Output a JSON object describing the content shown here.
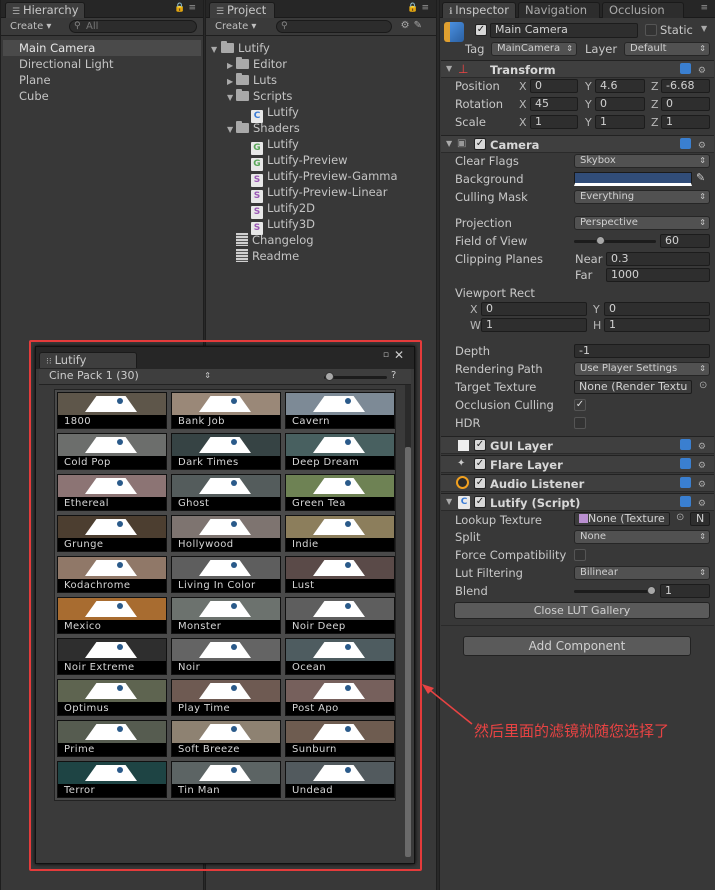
{
  "hierarchy": {
    "tab": "Hierarchy",
    "create": "Create ▾",
    "search_placeholder": "All",
    "items": [
      "Main Camera",
      "Directional Light",
      "Plane",
      "Cube"
    ]
  },
  "project": {
    "tab": "Project",
    "create": "Create ▾",
    "tree": {
      "root": "Lutify",
      "editor": "Editor",
      "luts": "Luts",
      "scripts": "Scripts",
      "script_file": "Lutify",
      "shaders": "Shaders",
      "shader_files": [
        "Lutify",
        "Lutify-Preview",
        "Lutify-Preview-Gamma",
        "Lutify-Preview-Linear",
        "Lutify2D",
        "Lutify3D"
      ],
      "changelog": "Changelog",
      "readme": "Readme"
    }
  },
  "inspector": {
    "tabs": [
      "Inspector",
      "Navigation",
      "Occlusion"
    ],
    "object_name": "Main Camera",
    "static_label": "Static",
    "tag_label": "Tag",
    "tag_value": "MainCamera",
    "layer_label": "Layer",
    "layer_value": "Default",
    "transform": {
      "title": "Transform",
      "position_label": "Position",
      "position": [
        "0",
        "4.6",
        "-6.68"
      ],
      "rotation_label": "Rotation",
      "rotation": [
        "45",
        "0",
        "0"
      ],
      "scale_label": "Scale",
      "scale": [
        "1",
        "1",
        "1"
      ],
      "axes": [
        "X",
        "Y",
        "Z"
      ]
    },
    "camera": {
      "title": "Camera",
      "clear_flags_label": "Clear Flags",
      "clear_flags": "Skybox",
      "background_label": "Background",
      "background_color": "#314d79",
      "culling_mask_label": "Culling Mask",
      "culling_mask": "Everything",
      "projection_label": "Projection",
      "projection": "Perspective",
      "fov_label": "Field of View",
      "fov": "60",
      "fov_fraction": 0.3,
      "clipping_label": "Clipping Planes",
      "near_label": "Near",
      "near": "0.3",
      "far_label": "Far",
      "far": "1000",
      "viewport_label": "Viewport Rect",
      "vp_x_label": "X",
      "vp_x": "0",
      "vp_y_label": "Y",
      "vp_y": "0",
      "vp_w_label": "W",
      "vp_w": "1",
      "vp_h_label": "H",
      "vp_h": "1",
      "depth_label": "Depth",
      "depth": "-1",
      "rendering_path_label": "Rendering Path",
      "rendering_path": "Use Player Settings",
      "target_texture_label": "Target Texture",
      "target_texture": "None (Render Textu",
      "occlusion_label": "Occlusion Culling",
      "hdr_label": "HDR"
    },
    "gui_layer": "GUI Layer",
    "flare_layer": "Flare Layer",
    "audio_listener": "Audio Listener",
    "lutify": {
      "title": "Lutify (Script)",
      "lookup_label": "Lookup Texture",
      "lookup": "None (Texture",
      "lookup_btn": "N",
      "split_label": "Split",
      "split": "None",
      "force_label": "Force Compatibility",
      "filtering_label": "Lut Filtering",
      "filtering": "Bilinear",
      "blend_label": "Blend",
      "blend": "1",
      "blend_fraction": 1.0,
      "close_btn": "Close LUT Gallery"
    },
    "add_component": "Add Component"
  },
  "lut_window": {
    "title": "Lutify",
    "pack": "Cine Pack 1 (30)",
    "help": "?",
    "luts": [
      {
        "name": "1800",
        "color": "#5e564a"
      },
      {
        "name": "Bank Job",
        "color": "#9a8878"
      },
      {
        "name": "Cavern",
        "color": "#7d8a96"
      },
      {
        "name": "Cold Pop",
        "color": "#6c6e6c"
      },
      {
        "name": "Dark Times",
        "color": "#364344"
      },
      {
        "name": "Deep Dream",
        "color": "#486060"
      },
      {
        "name": "Ethereal",
        "color": "#8c7474"
      },
      {
        "name": "Ghost",
        "color": "#545c5c"
      },
      {
        "name": "Green Tea",
        "color": "#6e8254"
      },
      {
        "name": "Grunge",
        "color": "#4c3e30"
      },
      {
        "name": "Hollywood",
        "color": "#7e7470"
      },
      {
        "name": "Indie",
        "color": "#8c7e5c"
      },
      {
        "name": "Kodachrome",
        "color": "#907868"
      },
      {
        "name": "Living In Color",
        "color": "#5e5e5e"
      },
      {
        "name": "Lust",
        "color": "#5a4a48"
      },
      {
        "name": "Mexico",
        "color": "#a86c30"
      },
      {
        "name": "Monster",
        "color": "#6c726e"
      },
      {
        "name": "Noir Deep",
        "color": "#5e5e5e"
      },
      {
        "name": "Noir Extreme",
        "color": "#2e2e2e"
      },
      {
        "name": "Noir",
        "color": "#646464"
      },
      {
        "name": "Ocean",
        "color": "#4e5c60"
      },
      {
        "name": "Optimus",
        "color": "#5e6450"
      },
      {
        "name": "Play Time",
        "color": "#6e5a52"
      },
      {
        "name": "Post Apo",
        "color": "#76605c"
      },
      {
        "name": "Prime",
        "color": "#565c50"
      },
      {
        "name": "Soft Breeze",
        "color": "#8e8272"
      },
      {
        "name": "Sunburn",
        "color": "#6e5c50"
      },
      {
        "name": "Terror",
        "color": "#1e4444"
      },
      {
        "name": "Tin Man",
        "color": "#5c6464"
      },
      {
        "name": "Undead",
        "color": "#525a5e"
      }
    ]
  },
  "annotation": "然后里面的滤镜就随您选择了"
}
